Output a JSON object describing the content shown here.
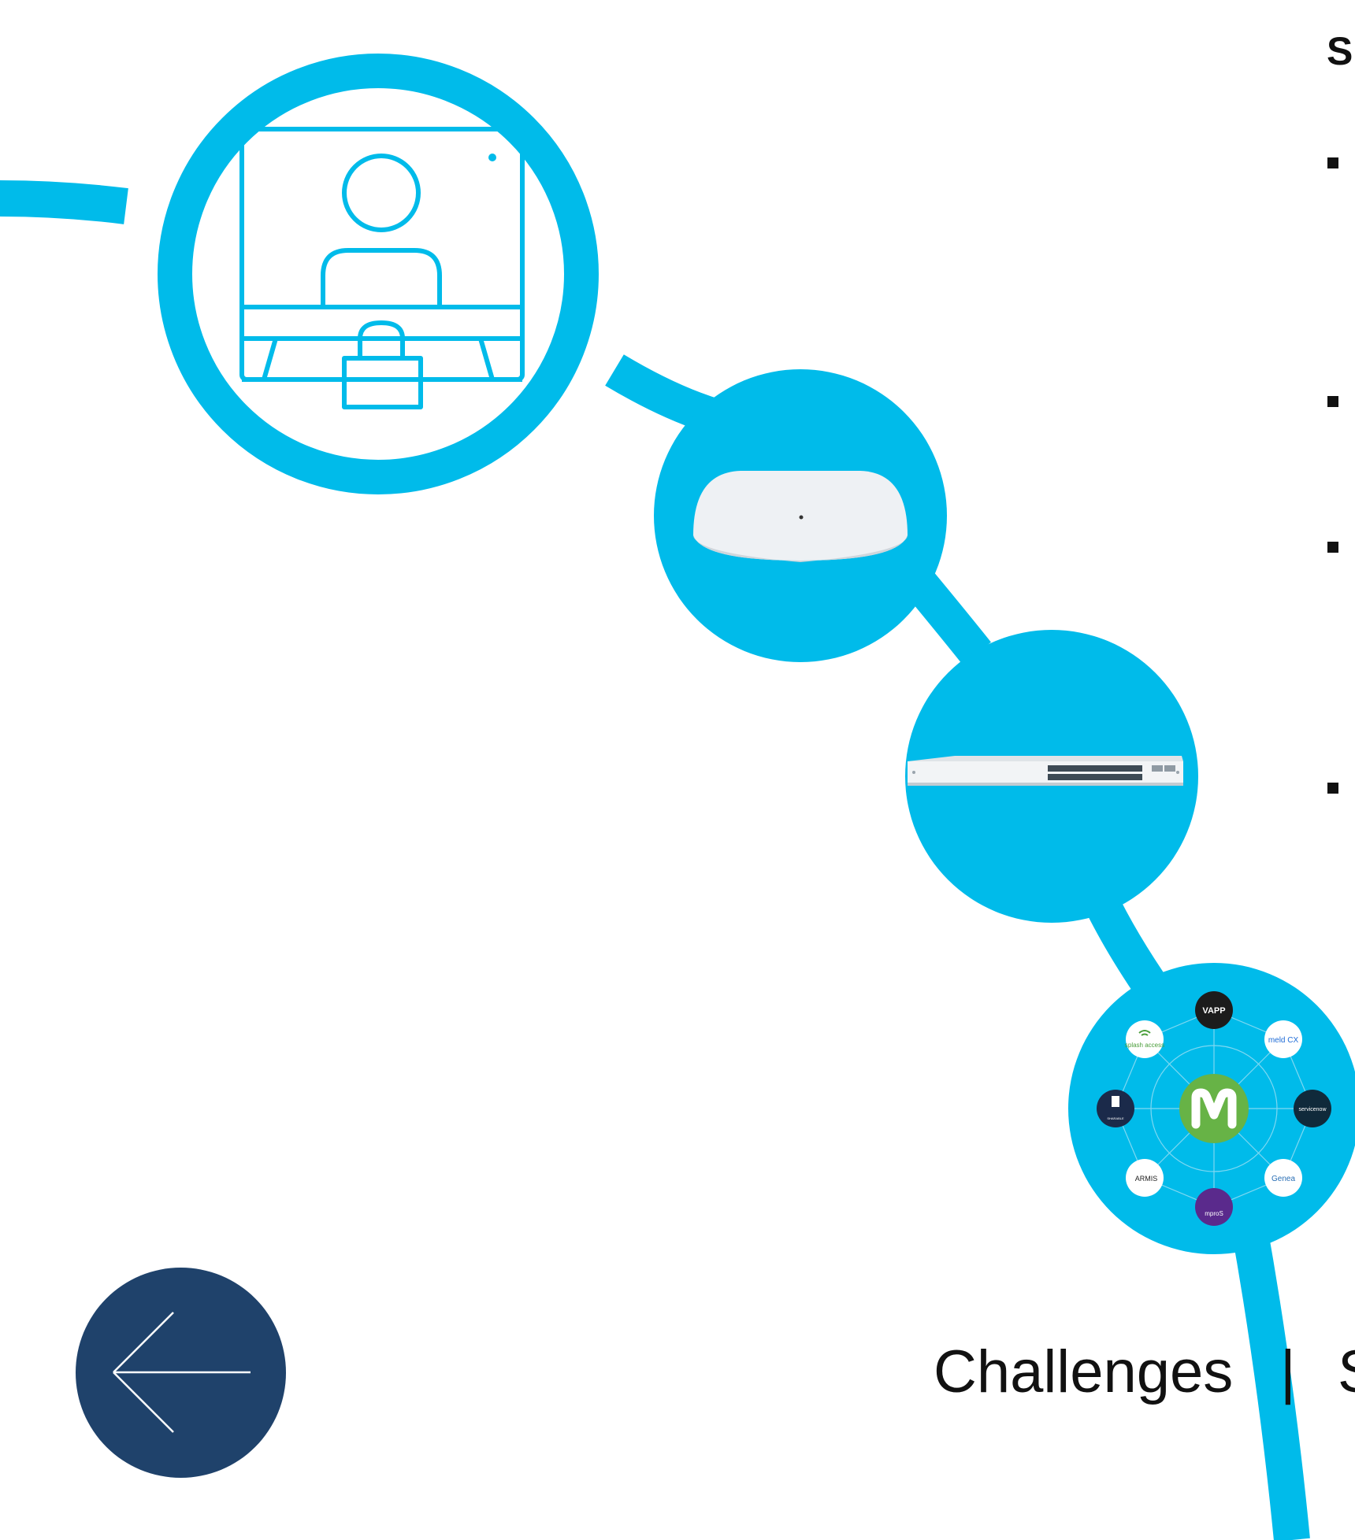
{
  "page": {
    "heading_fragment": "S",
    "bullet_count": 4
  },
  "colors": {
    "accent": "#00bbea",
    "back_button": "#1f426b",
    "device_white": "#f2f4f6"
  },
  "nodes": [
    {
      "name": "secure-remote-worker-icon"
    },
    {
      "name": "wireless-access-point-icon"
    },
    {
      "name": "network-switch-icon"
    },
    {
      "name": "partner-ecosystem-icon"
    }
  ],
  "ecosystem": {
    "hub": "meraki-logo",
    "partners": [
      {
        "label": "VAPP"
      },
      {
        "label": "meld CX"
      },
      {
        "label": "servicenow"
      },
      {
        "label": "Genea"
      },
      {
        "label": "mproS"
      },
      {
        "label": "ARMIS"
      },
      {
        "label": "SHARABLE"
      },
      {
        "label": "splash access"
      }
    ]
  },
  "footer_nav": {
    "challenges": "Challenges",
    "separator": "|",
    "next_fragment": "S"
  },
  "back_button": {
    "icon": "arrow-left-icon"
  }
}
